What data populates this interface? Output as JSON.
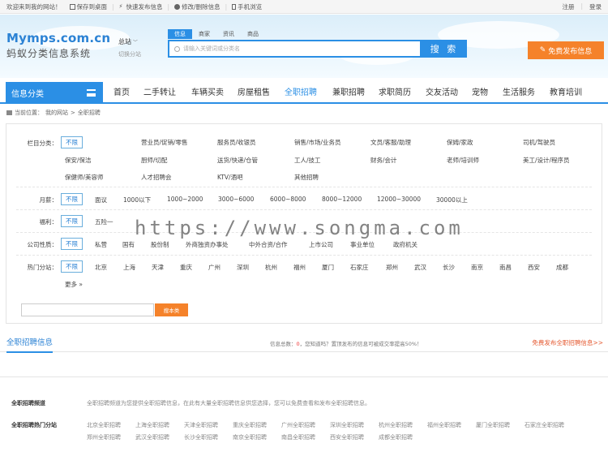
{
  "topbar": {
    "welcome": "欢迎来到我的网站！",
    "links": [
      "保存到桌面",
      "快速发布信息",
      "修改/删除信息",
      "手机浏览"
    ],
    "register": "注册",
    "login": "登录"
  },
  "logo": {
    "en": "Mymps.com.cn",
    "cn": "蚂蚁分类信息系统"
  },
  "city": {
    "name": "总站",
    "switch": "切换分站"
  },
  "search": {
    "tabs": [
      "信息",
      "商家",
      "资讯",
      "商品"
    ],
    "placeholder": "请输入关键词或分类名",
    "button": "搜 索"
  },
  "post_button": "免费发布信息",
  "nav": {
    "category_label": "信息分类",
    "items": [
      "首页",
      "二手转让",
      "车辆买卖",
      "房屋租售",
      "全职招聘",
      "兼职招聘",
      "求职简历",
      "交友活动",
      "宠物",
      "生活服务",
      "教育培训"
    ],
    "active": "全职招聘"
  },
  "breadcrumb": {
    "prefix": "当前位置：",
    "site": "我的网站",
    "current": "全职招聘"
  },
  "filters": {
    "column": {
      "label": "栏目分类：",
      "selected": "不限",
      "options": [
        "营业员/促销/零售",
        "服务员/收银员",
        "销售/市场/业务员",
        "文员/客服/助理",
        "保姆/家政",
        "司机/驾驶员",
        "保安/保洁",
        "厨师/切配",
        "送货/快递/仓管",
        "工人/技工",
        "财务/会计",
        "老师/培训师",
        "美工/设计/程序员",
        "保健师/美容师",
        "人才招聘会",
        "KTV/酒吧",
        "其他招聘"
      ]
    },
    "salary": {
      "label": "月薪：",
      "selected": "不限",
      "options": [
        "面议",
        "1000以下",
        "1000~2000",
        "3000~6000",
        "6000~8000",
        "8000~12000",
        "12000~30000",
        "30000以上"
      ]
    },
    "welfare": {
      "label": "福利：",
      "selected": "不限",
      "options": [
        "五险一"
      ]
    },
    "company": {
      "label": "公司性质：",
      "selected": "不限",
      "options": [
        "私营",
        "国有",
        "股份制",
        "外商独资办事处",
        "中外合资/合作",
        "上市公司",
        "事业单位",
        "政府机关"
      ]
    },
    "hotcity": {
      "label": "热门分站：",
      "selected": "不限",
      "options": [
        "北京",
        "上海",
        "天津",
        "重庆",
        "广州",
        "深圳",
        "杭州",
        "福州",
        "厦门",
        "石家庄",
        "郑州",
        "武汉",
        "长沙",
        "南京",
        "南昌",
        "西安",
        "成都"
      ],
      "more": "更多 »"
    },
    "keyword_button": "搜本类"
  },
  "list": {
    "title": "全职招聘信息",
    "stats_prefix": "信息总数：",
    "stats_count": "0",
    "stats_suffix": "，您知道吗？置顶发布的信息可被成交率提高50%！",
    "free_post": "免费发布全职招聘信息>>"
  },
  "footer": {
    "channel_label": "全职招聘频道",
    "channel_text": "全职招聘频道为您提供全职招聘信息，在此有大量全职招聘信息供您选择，您可以免费查看和发布全职招聘信息。",
    "hotcity_label": "全职招聘热门分站",
    "city_links": [
      "北京全职招聘",
      "上海全职招聘",
      "天津全职招聘",
      "重庆全职招聘",
      "广州全职招聘",
      "深圳全职招聘",
      "杭州全职招聘",
      "福州全职招聘",
      "厦门全职招聘",
      "石家庄全职招聘",
      "郑州全职招聘",
      "武汉全职招聘",
      "长沙全职招聘",
      "南京全职招聘",
      "南昌全职招聘",
      "西安全职招聘",
      "成都全职招聘"
    ]
  },
  "watermark": "https://www.songma.com"
}
